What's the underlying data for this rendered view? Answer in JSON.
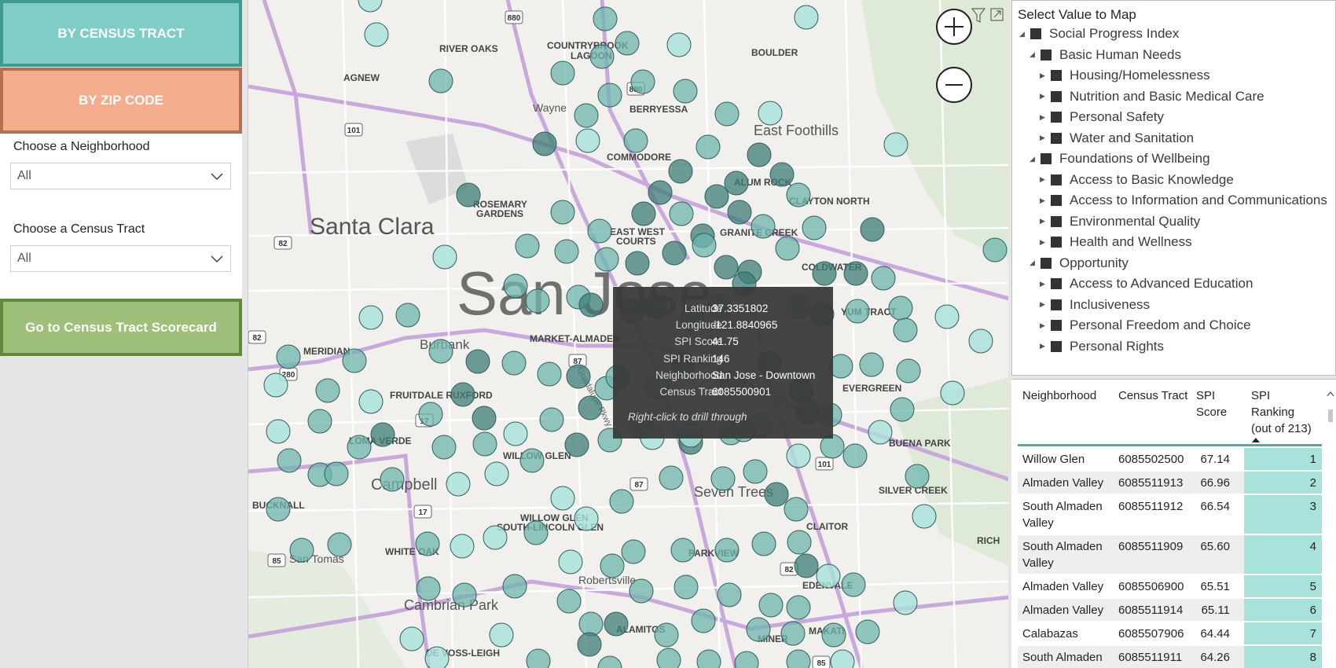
{
  "nav": {
    "census_tract": "BY CENSUS TRACT",
    "zip_code": "BY ZIP CODE",
    "scorecard": "Go to Census Tract Scorecard"
  },
  "filters": {
    "neighborhood_label": "Choose a Neighborhood",
    "neighborhood_value": "All",
    "tract_label": "Choose a Census Tract",
    "tract_value": "All"
  },
  "map": {
    "labels": {
      "santa_clara": "Santa Clara",
      "san_jose": "San Jose",
      "campbell": "Campbell",
      "cambrian_park": "Cambrian Park",
      "east_foothills": "East Foothills",
      "seven_trees": "Seven Trees",
      "burbank": "Burbank",
      "san_tomas": "San Tomas",
      "river_oaks": "RIVER OAKS",
      "countrybrook": "COUNTRYBROOK",
      "lagoon": "LAGOON",
      "boulder": "BOULDER",
      "agnew": "AGNEW",
      "wayne": "Wayne",
      "berryessa": "BERRYESSA",
      "commodore": "COMMODORE",
      "alum_rock": "ALUM ROCK",
      "clayton_north": "CLAYTON NORTH",
      "rosemary_gardens": "ROSEMARY",
      "rosemary_gardens_2": "GARDENS",
      "east_west_courts": "EAST WEST",
      "east_west_courts_2": "COURTS",
      "granite_creek": "GRANITE CREEK",
      "coldwater": "COLDWATER",
      "yum_tract": "YUM TRACT",
      "meridian": "MERIDIAN",
      "market_almaden": "MARKET-ALMADEN",
      "fruitdale": "FRUITDALE RUXFORD",
      "loma_verde": "LOMA VERDE",
      "willow_glen": "WILLOW GLEN",
      "evergreen": "EVERGREEN",
      "buena_park": "BUENA PARK",
      "silver_creek": "SILVER CREEK",
      "bucknall": "BUCKNALL",
      "willow_glen_south": "WILLOW GLEN",
      "south_lincoln": "SOUTH-LINCOLN GLEN",
      "white_oak": "WHITE OAK",
      "parkview": "PARKVIEW",
      "claitor": "CLAITOR",
      "robertsville": "Robertsville",
      "edenvale": "EDENVALE",
      "alamitos": "ALAMITOS",
      "miner": "MINER",
      "makati": "MAKATI",
      "de_voss": "DE VOSS-LEIGH",
      "rich": "RICH",
      "guadalupe": "Guadalupe Pkwy"
    },
    "shields": [
      "880",
      "880",
      "101",
      "82",
      "87",
      "280",
      "17",
      "17",
      "87",
      "85",
      "82",
      "101",
      "85",
      "82"
    ]
  },
  "tooltip": {
    "rows": [
      {
        "key": "Latitude",
        "value": "37.3351802"
      },
      {
        "key": "Longitude",
        "value": "-121.8840965"
      },
      {
        "key": "SPI Score",
        "value": "41.75"
      },
      {
        "key": "SPI Ranking",
        "value": "146"
      },
      {
        "key": "Neighborhood",
        "value": "San Jose - Downtown"
      },
      {
        "key": "Census Tract",
        "value": "6085500901"
      }
    ],
    "footer": "Right-click to drill through"
  },
  "tree": {
    "title": "Select Value to Map",
    "items": [
      {
        "label": "Social Progress Index",
        "level": 0,
        "arrow": "◢"
      },
      {
        "label": "Basic Human Needs",
        "level": 1,
        "arrow": "◢"
      },
      {
        "label": "Housing/Homelessness",
        "level": 2,
        "arrow": "▶"
      },
      {
        "label": "Nutrition and Basic Medical Care",
        "level": 2,
        "arrow": "▶"
      },
      {
        "label": "Personal Safety",
        "level": 2,
        "arrow": "▶"
      },
      {
        "label": "Water and Sanitation",
        "level": 2,
        "arrow": "▶"
      },
      {
        "label": "Foundations of Wellbeing",
        "level": 1,
        "arrow": "◢"
      },
      {
        "label": "Access to Basic Knowledge",
        "level": 2,
        "arrow": "▶"
      },
      {
        "label": "Access to Information and Communications",
        "level": 2,
        "arrow": "▶"
      },
      {
        "label": "Environmental Quality",
        "level": 2,
        "arrow": "▶"
      },
      {
        "label": "Health and Wellness",
        "level": 2,
        "arrow": "▶"
      },
      {
        "label": "Opportunity",
        "level": 1,
        "arrow": "◢"
      },
      {
        "label": "Access to Advanced Education",
        "level": 2,
        "arrow": "▶"
      },
      {
        "label": "Inclusiveness",
        "level": 2,
        "arrow": "▶"
      },
      {
        "label": "Personal Freedom and Choice",
        "level": 2,
        "arrow": "▶"
      },
      {
        "label": "Personal Rights",
        "level": 2,
        "arrow": "▶"
      }
    ]
  },
  "table": {
    "headers": {
      "neighborhood": "Neighborhood",
      "tract": "Census Tract",
      "score_1": "SPI",
      "score_2": "Score",
      "rank_1": "SPI",
      "rank_2": "Ranking",
      "rank_3": "(out of 213)"
    },
    "rows": [
      {
        "n1": "Willow Glen",
        "n2": "",
        "tract": "6085502500",
        "score": "67.14",
        "rank": "1"
      },
      {
        "n1": "Almaden Valley",
        "n2": "",
        "tract": "6085511913",
        "score": "66.96",
        "rank": "2"
      },
      {
        "n1": "South Almaden",
        "n2": "Valley",
        "tract": "6085511912",
        "score": "66.54",
        "rank": "3"
      },
      {
        "n1": "South Almaden",
        "n2": "Valley",
        "tract": "6085511909",
        "score": "65.60",
        "rank": "4"
      },
      {
        "n1": "Almaden Valley",
        "n2": "",
        "tract": "6085506900",
        "score": "65.51",
        "rank": "5"
      },
      {
        "n1": "Almaden Valley",
        "n2": "",
        "tract": "6085511914",
        "score": "65.11",
        "rank": "6"
      },
      {
        "n1": "Calabazas",
        "n2": "",
        "tract": "6085507906",
        "score": "64.44",
        "rank": "7"
      },
      {
        "n1": "South Almaden",
        "n2": "Valley",
        "tract": "6085511911",
        "score": "64.26",
        "rank": "8"
      }
    ]
  },
  "colors": {
    "light_bubble": "#a8e1dc",
    "medium_bubble": "#6db6ae",
    "dark_bubble": "#3d7e78",
    "rank_fill": "#a7e3db",
    "header_rule": "#3fb3a6"
  }
}
